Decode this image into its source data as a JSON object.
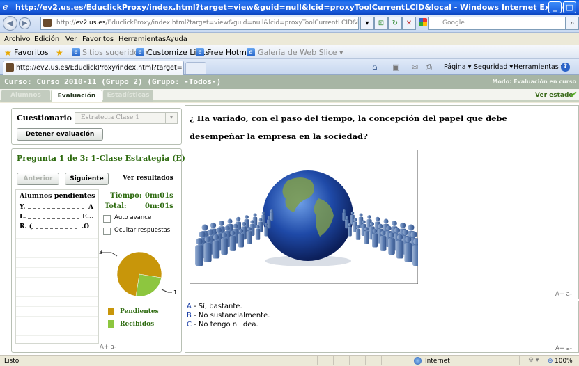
{
  "window": {
    "title": "http://ev2.us.es/EduclickProxy/index.html?target=view&guid=null&lcid=proxyToolCurrentLCID&local - Windows Internet Explorer",
    "controls": [
      "_",
      "□"
    ]
  },
  "address_bar": {
    "url_prefix": "http://",
    "url_host": "ev2.us.es",
    "url_rest": "/EduclickProxy/index.html?target=view&guid=null&lcid=proxyToolCurrentLCID&locale=esi",
    "search_placeholder": "Google"
  },
  "menu": [
    "Archivo",
    "Edición",
    "Ver",
    "Favoritos",
    "Herramientas",
    "Ayuda"
  ],
  "favorites_bar": {
    "favorites_label": "Favoritos",
    "suggested_sites": "Sitios sugeridos ▾",
    "customize_links": "Customize Links",
    "free_hotmail": "Free Hotmail",
    "web_slice": "Galería de Web Slice ▾"
  },
  "browser_tab": {
    "title": "http://ev2.us.es/EduclickProxy/index.html?target=vi..."
  },
  "command_bar": {
    "page": "Página ▾",
    "security": "Seguridad ▾",
    "tools": "Herramientas ▾"
  },
  "app": {
    "header_title": "Curso:  Curso 2010-11 (Grupo 2) (Grupo: -Todos-)",
    "mode": "Modo: Evaluación en curso",
    "tabs": [
      "Alumnos",
      "Evaluación",
      "Estadísticas"
    ],
    "active_tab": "Evaluación",
    "ver_estado": "Ver estado"
  },
  "quiz": {
    "label": "Cuestionario",
    "selected": "Estrategia Clase 1",
    "stop_button": "Detener evaluación"
  },
  "question_panel": {
    "title": "Pregunta 1 de 3: 1-Clase Estrategia (E)",
    "prev_button": "Anterior",
    "next_button": "Siguiente",
    "results_link": "Ver resultados",
    "students_header": "Alumnos pendientes",
    "students": [
      {
        "name": "Y.",
        "suffix": "A"
      },
      {
        "name": "L. ",
        "suffix": "E..."
      },
      {
        "name": "R. (",
        "suffix": ".O"
      }
    ],
    "time_label": "Tiempo:",
    "time_value": "0m:01s",
    "total_label": "Total:",
    "total_value": "0m:01s",
    "auto_advance": "Auto avance",
    "hide_answers": "Ocultar respuestas",
    "font_controls": "A+  a-"
  },
  "chart_data": {
    "type": "pie",
    "values": [
      3,
      1
    ],
    "series": [
      {
        "name": "Pendientes",
        "value": 3,
        "color": "#c8960a"
      },
      {
        "name": "Recibidos",
        "value": 1,
        "color": "#8dc63f"
      }
    ],
    "labels": [
      "3",
      "1"
    ]
  },
  "question": {
    "text_line1": "¿ Ha variado, con el paso del tiempo, la concepción del papel que debe",
    "text_line2": "desempeñar la empresa en la sociedad?",
    "font_controls": "A+  a-"
  },
  "answers": [
    {
      "letter": "A",
      "text": " - Sí, bastante."
    },
    {
      "letter": "B",
      "text": " - No sustancialmente."
    },
    {
      "letter": "C",
      "text": " - No tengo ni idea."
    }
  ],
  "answers_font_controls": "A+  a-",
  "status_bar": {
    "left": "Listo",
    "zone": "Internet",
    "zoom": "100%"
  },
  "colors": {
    "header_bg": "#a7b5a4",
    "title_green": "#2e6b10",
    "answer_letter": "#1a3fa6",
    "pending": "#c8960a",
    "received": "#8dc63f"
  }
}
